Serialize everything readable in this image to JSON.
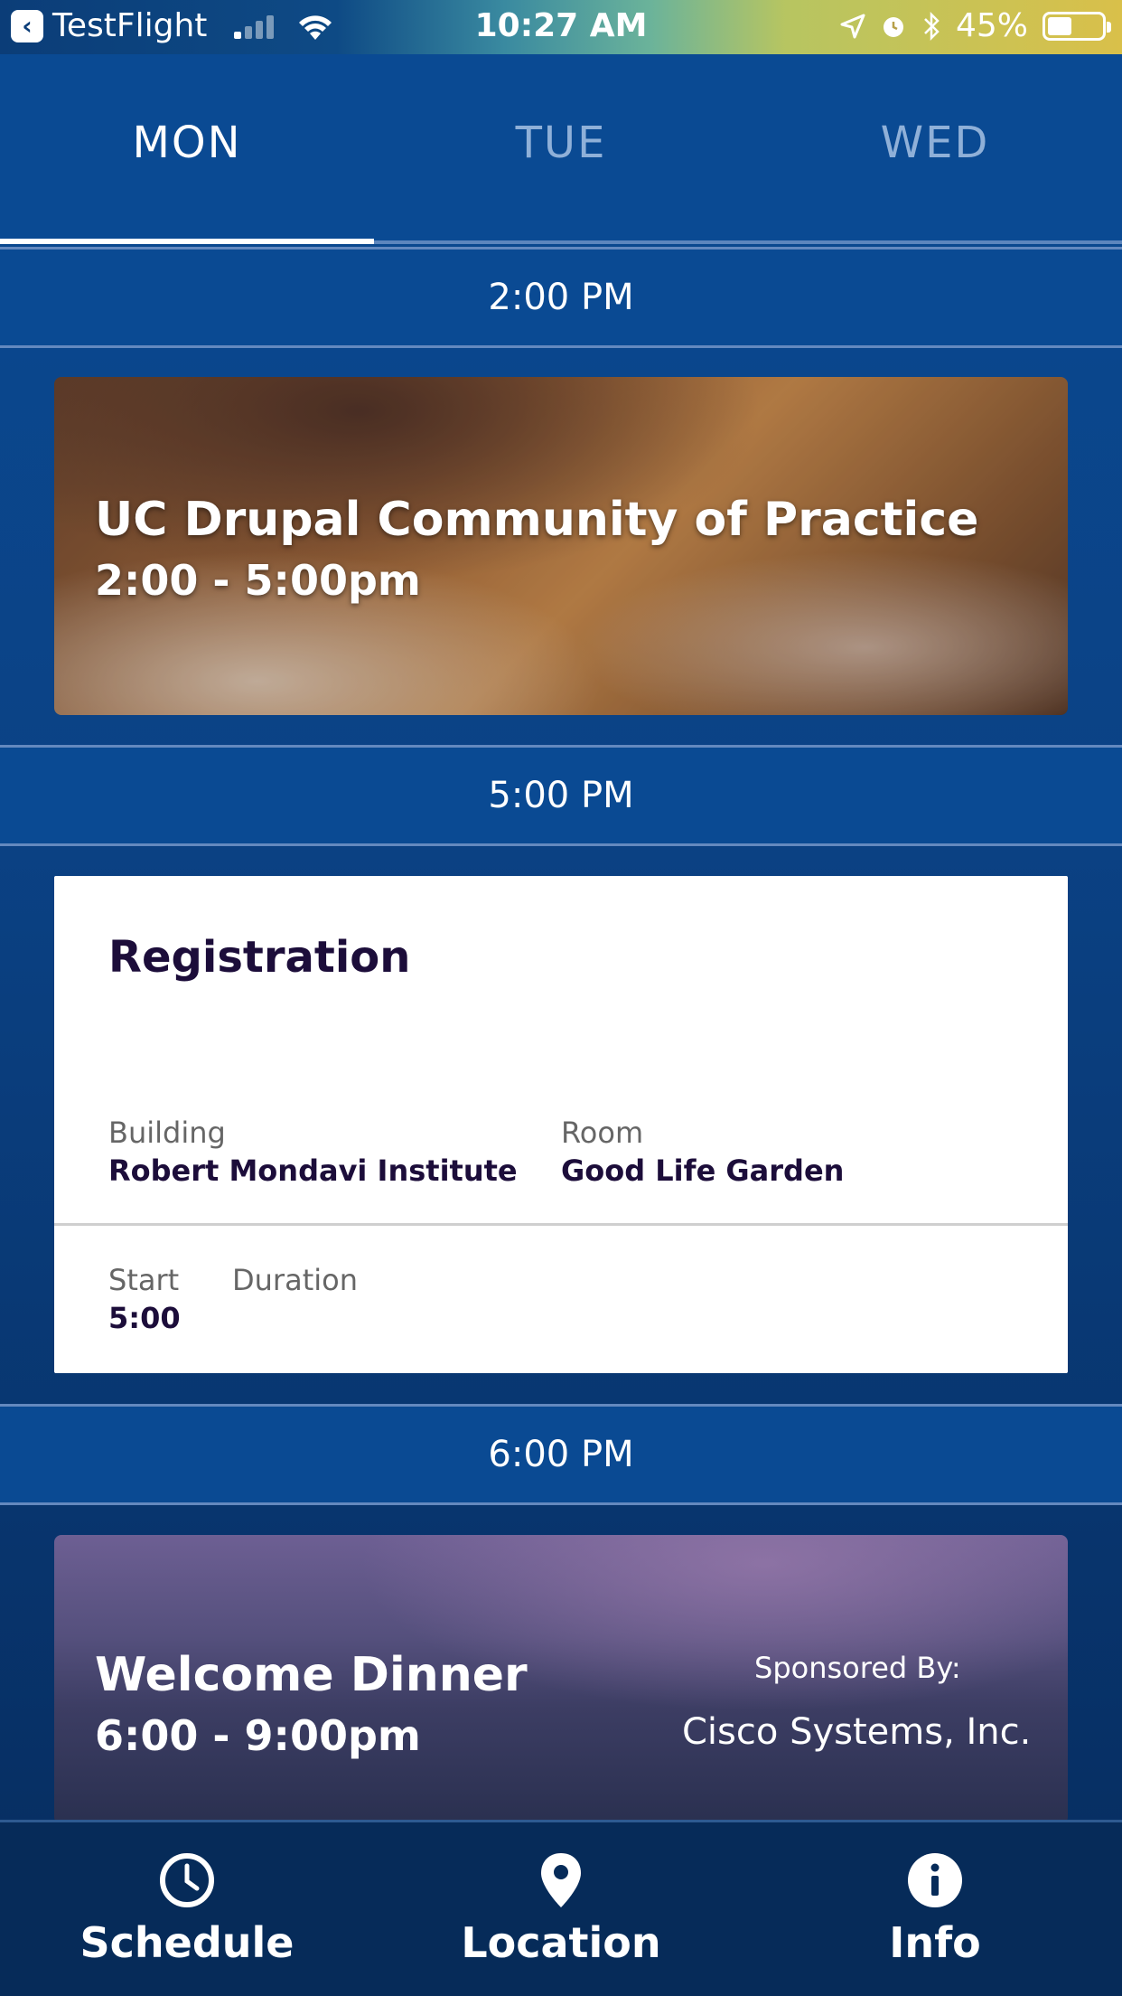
{
  "status_bar": {
    "back_app": "TestFlight",
    "time": "10:27 AM",
    "battery": "45%"
  },
  "tabs": [
    {
      "label": "MON",
      "active": true
    },
    {
      "label": "TUE",
      "active": false
    },
    {
      "label": "WED",
      "active": false
    }
  ],
  "schedule": [
    {
      "time": "2:00 PM",
      "event": {
        "title": "UC Drupal Community of Practice",
        "times": "2:00 - 5:00pm"
      }
    },
    {
      "time": "5:00 PM",
      "event": {
        "title": "Registration",
        "building_label": "Building",
        "building_value": "Robert Mondavi Institute",
        "room_label": "Room",
        "room_value": "Good Life Garden",
        "start_label": "Start",
        "start_value": "5:00",
        "duration_label": "Duration",
        "duration_value": ""
      }
    },
    {
      "time": "6:00 PM",
      "event": {
        "title": "Welcome Dinner",
        "times": "6:00 - 9:00pm",
        "sponsored_label": "Sponsored By:",
        "sponsor": "Cisco Systems, Inc."
      }
    }
  ],
  "bottom_nav": [
    {
      "label": "Schedule",
      "icon": "clock-icon"
    },
    {
      "label": "Location",
      "icon": "map-pin-icon"
    },
    {
      "label": "Info",
      "icon": "info-icon"
    }
  ]
}
